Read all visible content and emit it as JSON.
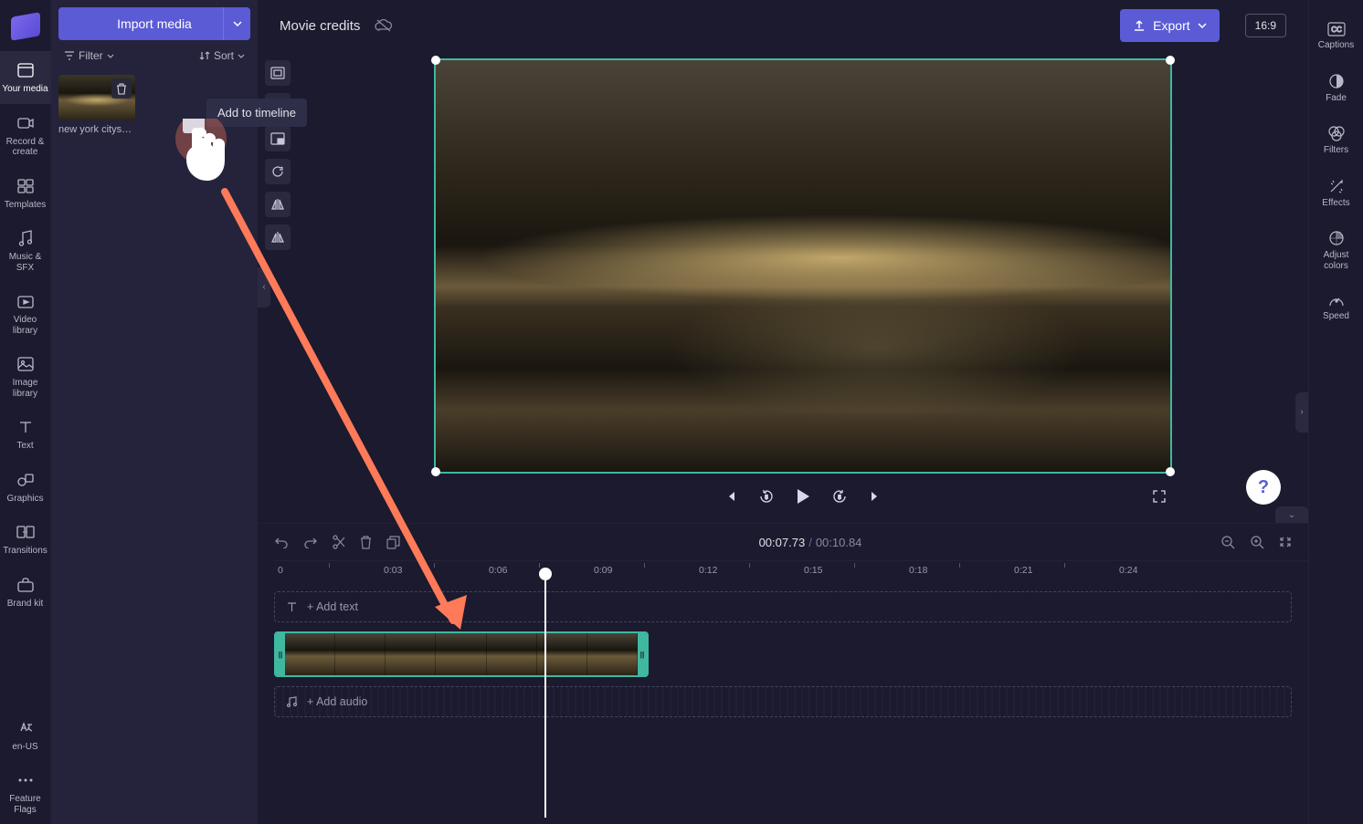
{
  "left_rail": {
    "items": [
      {
        "id": "your-media",
        "label": "Your media"
      },
      {
        "id": "record-create",
        "label": "Record & create"
      },
      {
        "id": "templates",
        "label": "Templates"
      },
      {
        "id": "music-sfx",
        "label": "Music & SFX"
      },
      {
        "id": "video-library",
        "label": "Video library"
      },
      {
        "id": "image-library",
        "label": "Image library"
      },
      {
        "id": "text",
        "label": "Text"
      },
      {
        "id": "graphics",
        "label": "Graphics"
      },
      {
        "id": "transitions",
        "label": "Transitions"
      },
      {
        "id": "brand-kit",
        "label": "Brand kit"
      }
    ],
    "footer": [
      {
        "id": "locale",
        "label": "en-US"
      },
      {
        "id": "feature-flags",
        "label": "Feature Flags"
      }
    ]
  },
  "media_panel": {
    "import_label": "Import media",
    "filter_label": "Filter",
    "sort_label": "Sort",
    "thumb_name": "new york citys…",
    "add_to_timeline": "Add to timeline"
  },
  "top_bar": {
    "title": "Movie credits",
    "export_label": "Export",
    "aspect_ratio": "16:9"
  },
  "playback": {
    "current": "00:07.73",
    "separator": "/",
    "total": "00:10.84"
  },
  "timeline": {
    "add_text": "+ Add text",
    "add_audio": "+ Add audio",
    "ticks": [
      "0",
      "0:03",
      "0:06",
      "0:09",
      "0:12",
      "0:15",
      "0:18",
      "0:21",
      "0:24"
    ]
  },
  "right_rail": {
    "items": [
      {
        "id": "captions",
        "label": "Captions"
      },
      {
        "id": "fade",
        "label": "Fade"
      },
      {
        "id": "filters",
        "label": "Filters"
      },
      {
        "id": "effects",
        "label": "Effects"
      },
      {
        "id": "adjust-colors",
        "label": "Adjust colors"
      },
      {
        "id": "speed",
        "label": "Speed"
      }
    ]
  },
  "help": "?"
}
